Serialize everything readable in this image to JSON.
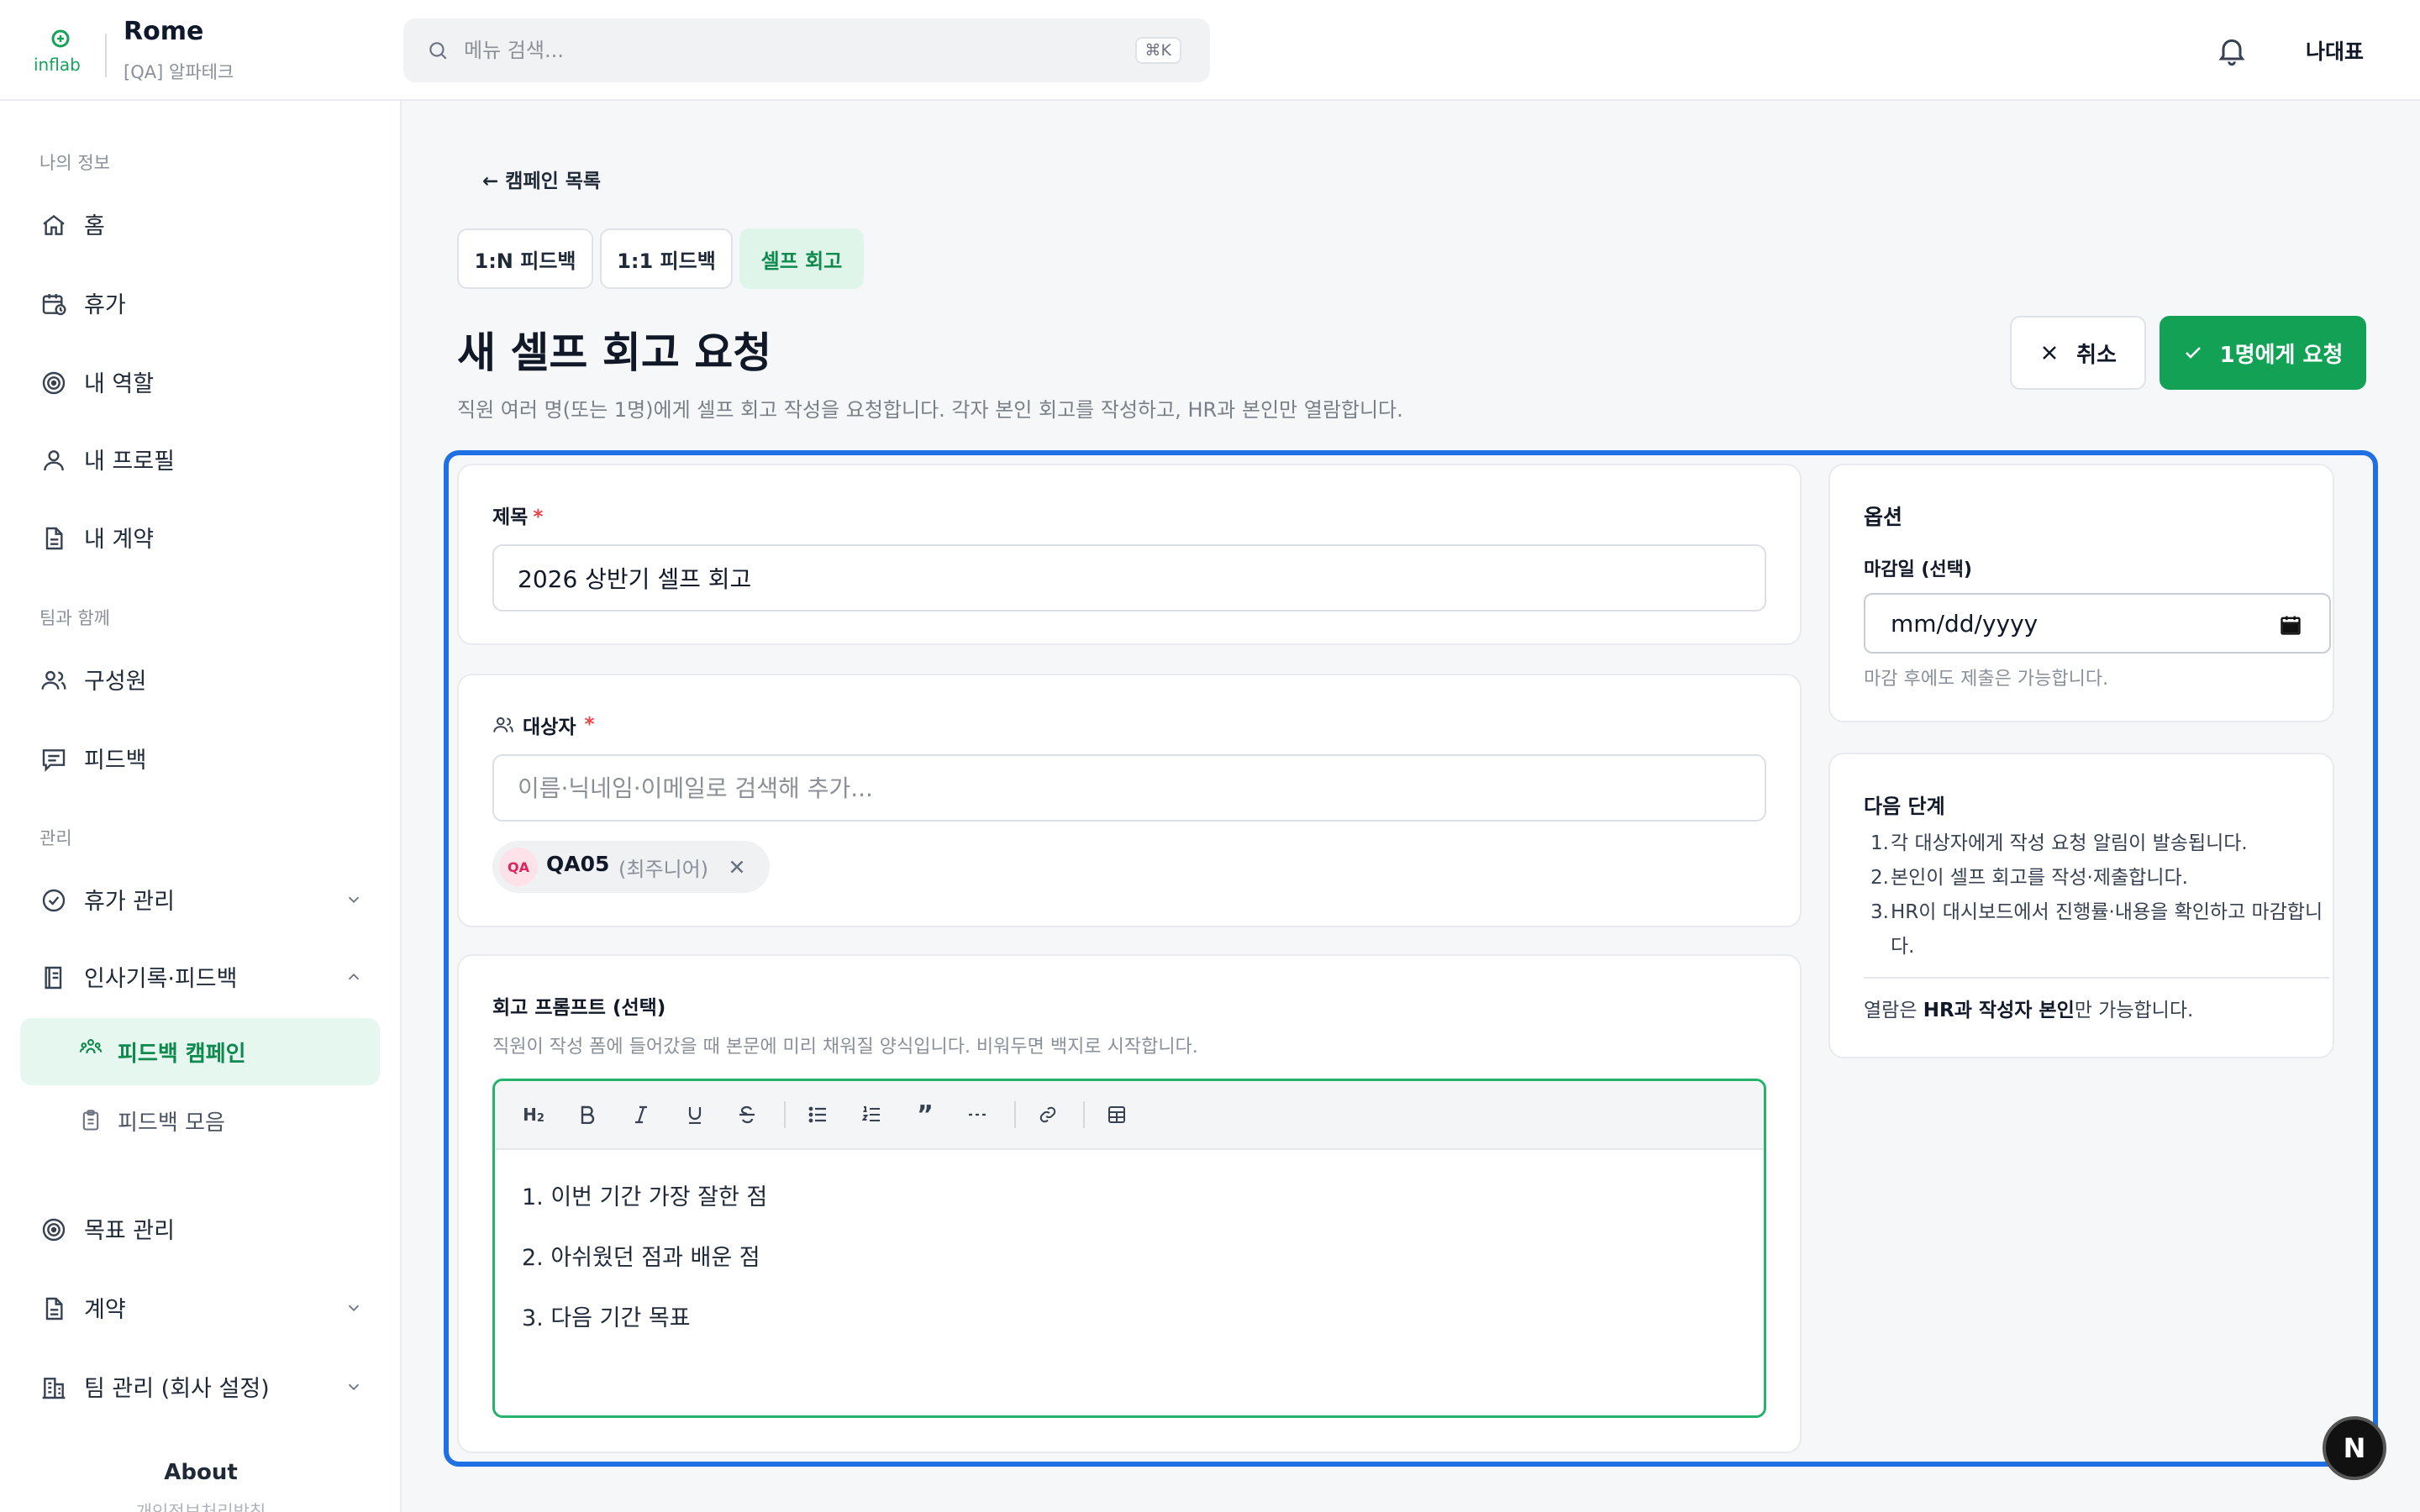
{
  "header": {
    "app_name": "Rome",
    "org_name": "[QA] 알파테크",
    "logo_text": "inflab",
    "search_placeholder": "메뉴 검색...",
    "search_shortcut": "⌘K",
    "user_name": "나대표"
  },
  "sidebar": {
    "section_my": "나의 정보",
    "section_team": "팀과 함께",
    "section_admin": "관리",
    "items": [
      {
        "label": "홈",
        "icon": "home-icon"
      },
      {
        "label": "휴가",
        "icon": "calendar-icon"
      },
      {
        "label": "내 역할",
        "icon": "target-icon"
      },
      {
        "label": "내 프로필",
        "icon": "user-icon"
      },
      {
        "label": "내 계약",
        "icon": "document-icon"
      },
      {
        "label": "구성원",
        "icon": "users-icon"
      },
      {
        "label": "피드백",
        "icon": "message-icon"
      },
      {
        "label": "휴가 관리",
        "icon": "check-circle-icon"
      },
      {
        "label": "인사기록·피드백",
        "icon": "book-icon"
      },
      {
        "label": "피드백 캠페인",
        "icon": "people-group-icon"
      },
      {
        "label": "피드백 모음",
        "icon": "clipboard-icon"
      },
      {
        "label": "목표 관리",
        "icon": "target-icon"
      },
      {
        "label": "계약",
        "icon": "document-icon"
      },
      {
        "label": "팀 관리 (회사 설정)",
        "icon": "building-icon"
      }
    ],
    "about": "About",
    "about_sub": "개인정보처리방침"
  },
  "main": {
    "back_link": "← 캠페인 목록",
    "tabs": [
      {
        "label": "1:N 피드백",
        "active": false
      },
      {
        "label": "1:1 피드백",
        "active": false
      },
      {
        "label": "셀프 회고",
        "active": true
      }
    ],
    "title": "새 셀프 회고 요청",
    "description": "직원 여러 명(또는 1명)에게 셀프 회고 작성을 요청합니다. 각자 본인 회고를 작성하고, HR과 본인만 열람합니다.",
    "cancel_label": "취소",
    "submit_label": "1명에게 요청"
  },
  "form": {
    "title_label": "제목",
    "required_mark": "*",
    "title_value": "2026 상반기 셀프 회고",
    "target_label": "대상자",
    "target_placeholder": "이름·닉네임·이메일로 검색해 추가...",
    "chip": {
      "avatar": "QA",
      "name": "QA05",
      "role": "(최주니어)"
    },
    "prompt_label": "회고 프롬프트 (선택)",
    "prompt_help": "직원이 작성 폼에 들어갔을 때 본문에 미리 채워질 양식입니다. 비워두면 백지로 시작합니다.",
    "toolbar": [
      "heading-2-icon",
      "bold-icon",
      "italic-icon",
      "underline-icon",
      "strikethrough-icon",
      "bullet-list-icon",
      "ordered-list-icon",
      "quote-icon",
      "horizontal-rule-icon",
      "link-icon",
      "table-icon"
    ],
    "editor_lines": [
      "1. 이번 기간 가장 잘한 점",
      "2. 아쉬웠던 점과 배운 점",
      "3. 다음 기간 목표"
    ]
  },
  "options": {
    "title": "옵션",
    "deadline_label": "마감일 (선택)",
    "deadline_placeholder": "mm/dd/yyyy",
    "deadline_help": "마감 후에도 제출은 가능합니다."
  },
  "next_steps": {
    "title": "다음 단계",
    "steps": [
      "각 대상자에게 작성 요청 알림이 발송됩니다.",
      "본인이 셀프 회고를 작성·제출합니다.",
      "HR이 대시보드에서 진행률·내용을 확인하고 마감합니다."
    ],
    "note_prefix": "열람은 ",
    "note_bold": "HR과 작성자 본인",
    "note_suffix": "만 가능합니다."
  },
  "colors": {
    "accent": "#12a155",
    "focus": "#1f6fe5",
    "active_bg": "#e6f7ef"
  }
}
